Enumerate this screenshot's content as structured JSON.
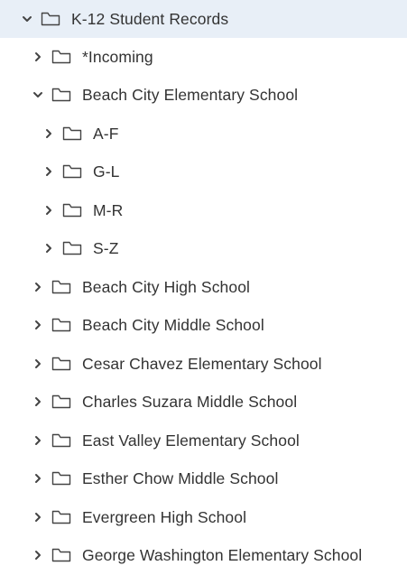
{
  "tree": {
    "root": {
      "label": "K-12 Student Records",
      "expanded": true,
      "selected": true
    },
    "incoming": {
      "label": "*Incoming",
      "expanded": false
    },
    "beach_city_elementary": {
      "label": "Beach City Elementary School",
      "expanded": true,
      "children": {
        "a_f": {
          "label": "A-F",
          "expanded": false
        },
        "g_l": {
          "label": "G-L",
          "expanded": false
        },
        "m_r": {
          "label": "M-R",
          "expanded": false
        },
        "s_z": {
          "label": "S-Z",
          "expanded": false
        }
      }
    },
    "beach_city_high": {
      "label": "Beach City High School",
      "expanded": false
    },
    "beach_city_middle": {
      "label": "Beach City Middle School",
      "expanded": false
    },
    "cesar_chavez_elementary": {
      "label": "Cesar Chavez Elementary School",
      "expanded": false
    },
    "charles_suzara_middle": {
      "label": "Charles Suzara Middle School",
      "expanded": false
    },
    "east_valley_elementary": {
      "label": "East Valley Elementary School",
      "expanded": false
    },
    "esther_chow_middle": {
      "label": "Esther Chow Middle School",
      "expanded": false
    },
    "evergreen_high": {
      "label": "Evergreen High School",
      "expanded": false
    },
    "george_washington_elementary": {
      "label": "George Washington Elementary School",
      "expanded": false
    }
  },
  "colors": {
    "selected_row_bg": "#e8eff7",
    "text": "#333333",
    "icon_stroke": "#444444"
  },
  "icons": {
    "expand": "chevron-right-icon",
    "collapse": "chevron-down-icon",
    "folder": "folder-icon"
  }
}
